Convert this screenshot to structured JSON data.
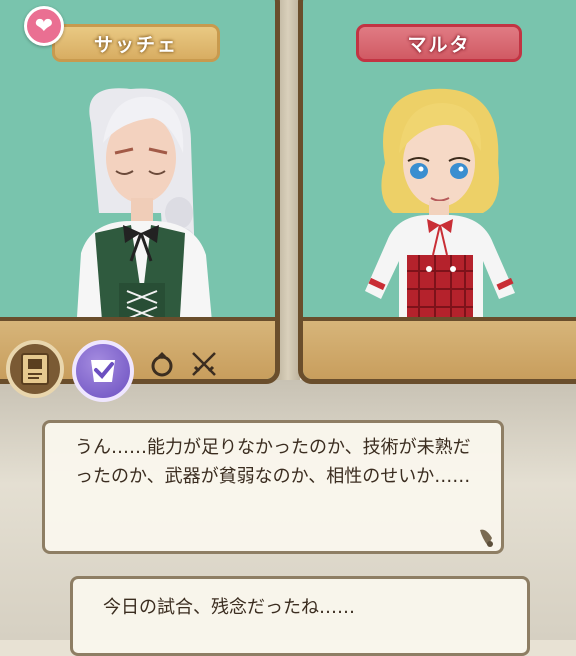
{
  "characters": {
    "left": {
      "name": "サッチェ"
    },
    "right": {
      "name": "マルタ"
    }
  },
  "icons": {
    "favorite": "heart-icon",
    "book": "book-icon",
    "badge": "check-badge-icon",
    "ring": "ring-icon",
    "swords": "crossed-swords-icon"
  },
  "dialogue": {
    "top_text": "うん……能力が足りなかったのか、技術が未熟だったのか、武器が貧弱なのか、相性のせいか……",
    "bottom_text": "今日の試合、残念だったね……"
  },
  "colors": {
    "panel_bg": "#79c4ad",
    "left_tag": "#d8ad62",
    "right_tag": "#d15a64"
  }
}
